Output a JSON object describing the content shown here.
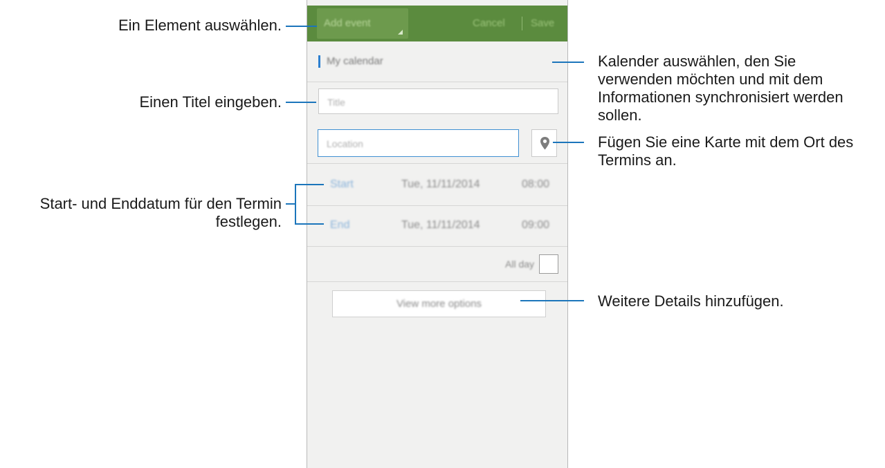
{
  "callouts": {
    "select_item": "Ein Element auswählen.",
    "calendar_line1": "Kalender auswählen, den Sie",
    "calendar_line2": "verwenden möchten und mit dem",
    "calendar_line3": "Informationen synchronisiert werden",
    "calendar_line4": "sollen.",
    "title": "Einen Titel eingeben.",
    "map_line1": "Fügen Sie eine Karte mit dem Ort des",
    "map_line2": "Termins an.",
    "dates_line1": "Start- und Enddatum für den Termin",
    "dates_line2": "festlegen.",
    "details": "Weitere Details hinzufügen."
  },
  "header": {
    "dropdown_label": "Add event",
    "cancel_label": "Cancel",
    "save_label": "Save"
  },
  "calendar": {
    "name": "My calendar"
  },
  "form": {
    "title_placeholder": "Title",
    "location_placeholder": "Location",
    "start_label": "Start",
    "start_date": "Tue, 11/11/2014",
    "start_time": "08:00",
    "end_label": "End",
    "end_date": "Tue, 11/11/2014",
    "end_time": "09:00",
    "all_day_label": "All day",
    "all_day_checked": false,
    "more_options_label": "View more options"
  },
  "icons": {
    "location": "map-pin-icon",
    "dropdown": "dropdown-corner-icon"
  },
  "colors": {
    "header_bg": "#5b8b3e",
    "callout_line": "#1b75bb",
    "calendar_accent": "#2c7fcf"
  }
}
